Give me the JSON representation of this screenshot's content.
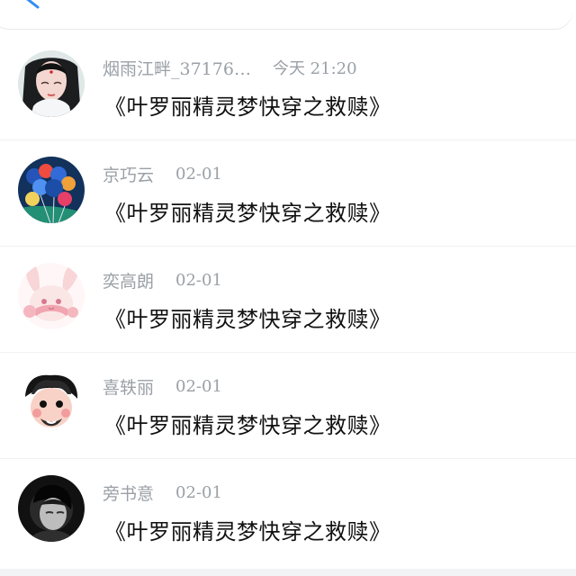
{
  "header": {
    "back_icon": "back-arrow-icon"
  },
  "comments": [
    {
      "username": "烟雨江畔_37176…",
      "time": "今天 21:20",
      "text": "《叶罗丽精灵梦快穿之救赎》",
      "avatar": "avatar-ancient-girl"
    },
    {
      "username": "京巧云",
      "time": "02-01",
      "text": "《叶罗丽精灵梦快穿之救赎》",
      "avatar": "avatar-balloons"
    },
    {
      "username": "奕高朗",
      "time": "02-01",
      "text": "《叶罗丽精灵梦快穿之救赎》",
      "avatar": "avatar-pink-bunny"
    },
    {
      "username": "喜轶丽",
      "time": "02-01",
      "text": "《叶罗丽精灵梦快穿之救赎》",
      "avatar": "avatar-cartoon-boy"
    },
    {
      "username": "旁书意",
      "time": "02-01",
      "text": "《叶罗丽精灵梦快穿之救赎》",
      "avatar": "avatar-dark-portrait"
    }
  ],
  "colors": {
    "accent": "#2f8ef5",
    "meta": "#9aa0a6",
    "text": "#111111"
  }
}
